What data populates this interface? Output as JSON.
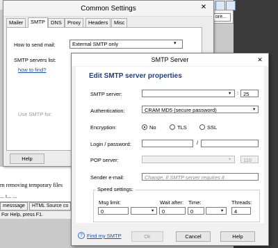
{
  "background_app": {
    "more_button": "ore...",
    "text_line": "rn removing temporary files",
    "text_line2": "... t... ...",
    "tabs": [
      "messsage",
      "HTML Source co"
    ],
    "status_bar": "For Help, press F1."
  },
  "common_settings": {
    "title": "Common Settings",
    "tabs": [
      "Mailer",
      "SMTP",
      "DNS",
      "Proxy",
      "Headers",
      "Misc"
    ],
    "active_tab": "SMTP",
    "how_to_send_label": "How to send mail:",
    "how_to_send_value": "External SMTP only",
    "smtp_servers_label": "SMTP servers list:",
    "how_to_find": "how to find?",
    "use_smtp_for": "Use SMTP for:",
    "help_button": "Help"
  },
  "smtp_dialog": {
    "title": "SMTP Server",
    "heading": "Edit SMTP server properties",
    "server_label": "SMTP server:",
    "server_value": "",
    "port_value": "25",
    "auth_label": "Authentication:",
    "auth_value": "CRAM MD5 (secure password)",
    "encryption_label": "Encryption:",
    "encryption_options": [
      "No",
      "TLS",
      "SSL"
    ],
    "encryption_selected": "No",
    "login_label": "Login / password:",
    "login_value": "",
    "password_value": "",
    "pop_label": "POP server:",
    "pop_port": "110",
    "sender_label": "Sender e-mail:",
    "sender_placeholder": "Change, if SMTP server requires it",
    "speed_settings_label": "Speed settings:",
    "msg_limit_label": "Msg limit:",
    "msg_limit_value": "0",
    "wait_after_label": "Wait after:",
    "wait_after_value": "0",
    "time_label": "Time:",
    "time_value": "0",
    "threads_label": "Threads:",
    "threads_value": "4",
    "find_smtp": "Find my SMTP",
    "ok_button": "Ok",
    "cancel_button": "Cancel",
    "help_button": "Help"
  }
}
